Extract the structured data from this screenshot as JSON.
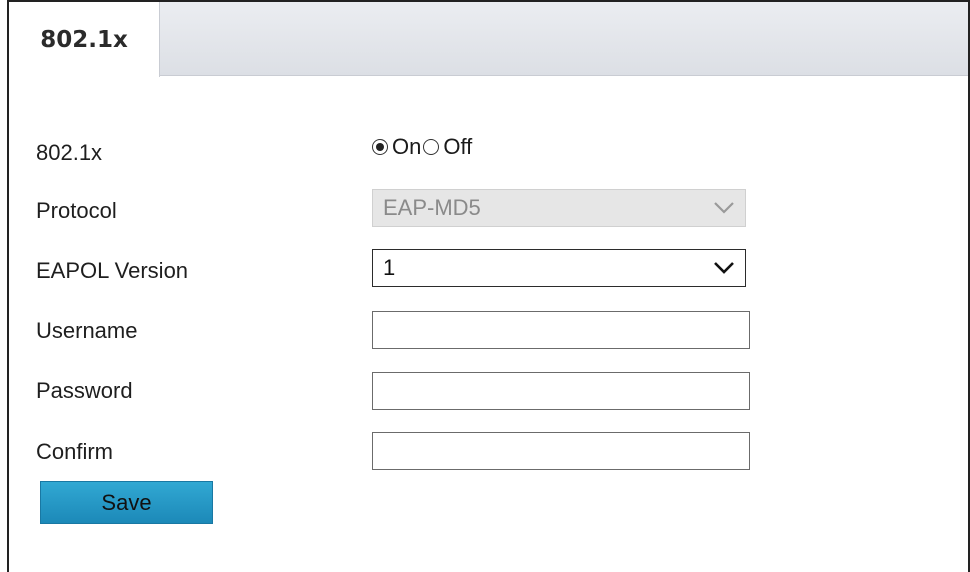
{
  "tab": {
    "label": "802.1x"
  },
  "form": {
    "enable": {
      "label": "802.1x",
      "options": {
        "on": "On",
        "off": "Off"
      },
      "selected": "On"
    },
    "protocol": {
      "label": "Protocol",
      "value": "EAP-MD5",
      "disabled": true
    },
    "eapol_version": {
      "label": "EAPOL Version",
      "value": "1"
    },
    "username": {
      "label": "Username",
      "value": ""
    },
    "password": {
      "label": "Password",
      "value": ""
    },
    "confirm": {
      "label": "Confirm",
      "value": ""
    }
  },
  "actions": {
    "save_label": "Save"
  },
  "colors": {
    "save_button": "#1c89b8",
    "disabled_select": "#e6e6e6",
    "tab_bar": "#dcdfe5"
  },
  "icons": {
    "select_arrow": "chevron-down-icon"
  }
}
